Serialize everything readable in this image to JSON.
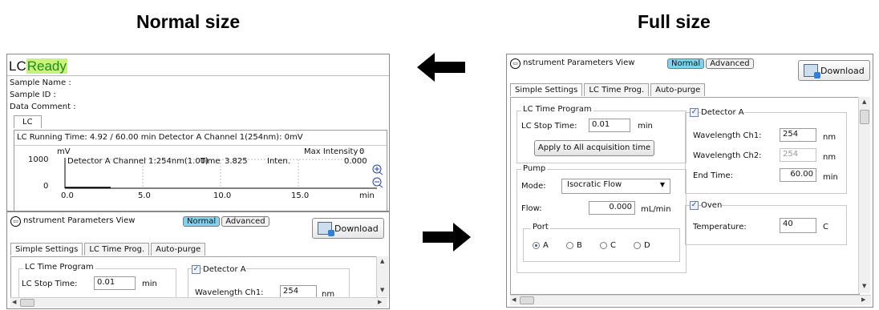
{
  "headings": {
    "normal": "Normal size",
    "full": "Full size"
  },
  "lc_status": {
    "title_prefix": "LC",
    "status": "Ready",
    "sample_name": "Sample Name :",
    "sample_id": "Sample ID :",
    "data_comment": "Data Comment :",
    "tab": "LC",
    "running_line": "LC Running Time: 4.92 / 60.00 min Detector A Channel 1(254nm): 0mV",
    "plot": {
      "ylabel": "mV",
      "max_label": "Max Intensity :",
      "max_value": "0",
      "y_ticks": [
        "1000",
        "0"
      ],
      "x_ticks": [
        "0.0",
        "5.0",
        "10.0",
        "15.0"
      ],
      "x_unit": "min",
      "readout_channel": "Detector A Channel 1:254nm(1.00)",
      "readout_time_label": "Time",
      "readout_time": "3.825",
      "readout_inten_label": "Inten.",
      "readout_inten": "0.000"
    }
  },
  "instrument": {
    "title_letter": "I",
    "title_rest": "nstrument Parameters View",
    "mode_normal": "Normal",
    "mode_advanced": "Advanced",
    "download": "Download",
    "tabs": [
      "Simple Settings",
      "LC Time Prog.",
      "Auto-purge"
    ],
    "lc_time_program": "LC Time Program",
    "lc_stop_time_label": "LC Stop Time:",
    "lc_stop_time": "0.01",
    "min": "min",
    "apply_button": "Apply to All acquisition time",
    "detector": "Detector A",
    "wl_ch1_label": "Wavelength Ch1:",
    "wl_ch1": "254",
    "wl_ch2_label": "Wavelength Ch2:",
    "wl_ch2": "254",
    "nm": "nm",
    "end_time_label": "End Time:",
    "end_time": "60.00",
    "pump": "Pump",
    "mode_label": "Mode:",
    "mode_value": "Isocratic Flow",
    "flow_label": "Flow:",
    "flow": "0.000",
    "flow_unit": "mL/min",
    "port": "Port",
    "ports": [
      "A",
      "B",
      "C",
      "D"
    ],
    "port_selected": "A",
    "oven": "Oven",
    "temperature_label": "Temperature:",
    "temperature": "40",
    "temp_unit": "C"
  },
  "colors": {
    "ready_bg": "#c9f27c",
    "ready_text": "#1e8c1e",
    "accent": "#2a5cc7"
  }
}
